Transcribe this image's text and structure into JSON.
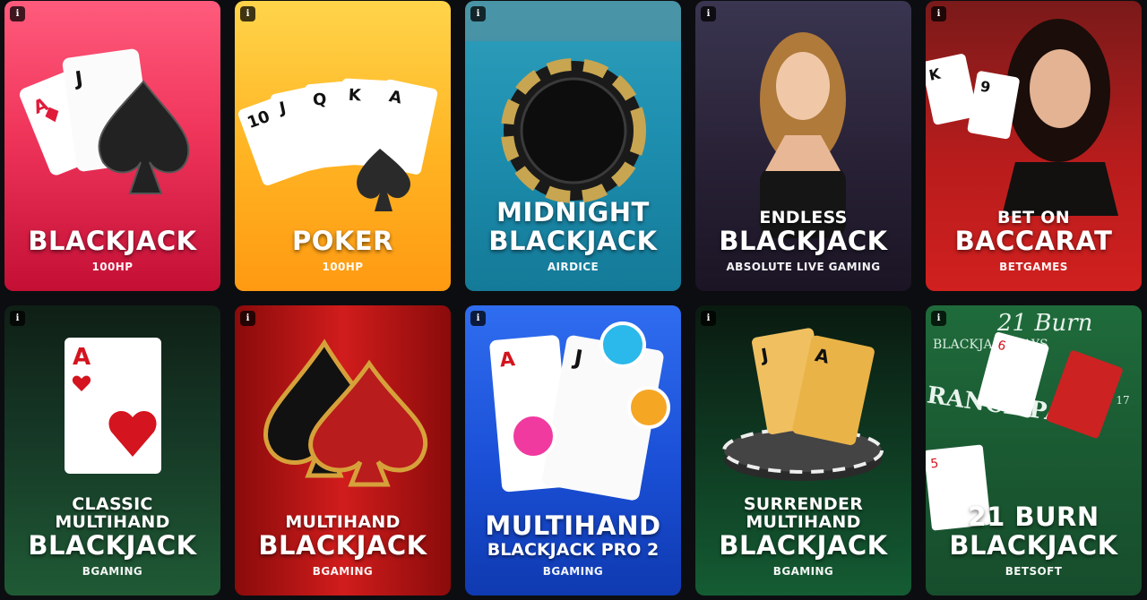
{
  "info_glyph": "i",
  "tiles": [
    {
      "pre": "",
      "title": "BLACKJACK",
      "sub2": "",
      "provider": "100HP"
    },
    {
      "pre": "",
      "title": "POKER",
      "sub2": "",
      "provider": "100HP"
    },
    {
      "pre": "MIDNIGHT",
      "title": "BLACKJACK",
      "sub2": "",
      "provider": "AIRDICE"
    },
    {
      "pre": "ENDLESS",
      "title": "BLACKJACK",
      "sub2": "",
      "provider": "ABSOLUTE LIVE GAMING"
    },
    {
      "pre": "BET ON",
      "title": "BACCARAT",
      "sub2": "",
      "provider": "BETGAMES"
    },
    {
      "pre": "CLASSIC",
      "pre2": "MULTIHAND",
      "title": "BLACKJACK",
      "sub2": "",
      "provider": "BGAMING"
    },
    {
      "pre": "MULTIHAND",
      "title": "BLACKJACK",
      "sub2": "",
      "provider": "BGAMING"
    },
    {
      "pre": "",
      "title": "MULTIHAND",
      "sub2": "BLACKJACK PRO 2",
      "provider": "BGAMING"
    },
    {
      "pre": "SURRENDER",
      "pre2": "MULTIHAND",
      "title": "BLACKJACK",
      "sub2": "",
      "provider": "BGAMING"
    },
    {
      "pre": "21 BURN",
      "title": "BLACKJACK",
      "sub2": "",
      "provider": "BETSOFT"
    }
  ],
  "art_text": {
    "card_j": "J",
    "card_a": "A",
    "card_q": "Q",
    "card_k": "K",
    "card_10": "10",
    "card_9": "9",
    "card_6": "6",
    "card_5": "5",
    "felt_21burn": "21 Burn",
    "felt_insurance": "RANCE PAYS",
    "felt_blackjack_pays": "BLACKJACK PAYS",
    "felt_soft17": "ON SOFT 17"
  }
}
